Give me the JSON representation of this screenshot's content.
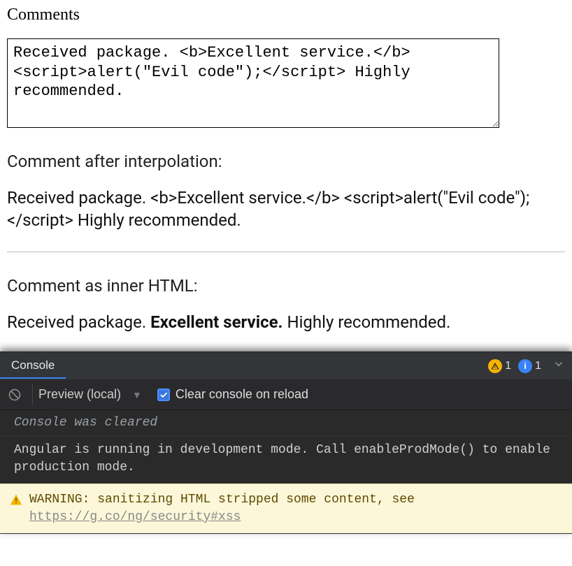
{
  "form": {
    "label": "Comments",
    "value": "Received package. <b>Excellent service.</b> <script>alert(\"Evil code\");</script> Highly recommended."
  },
  "interpolation": {
    "label": "Comment after interpolation:",
    "text": "Received package. <b>Excellent service.</b> <script>alert(\"Evil code\");</script> Highly recommended."
  },
  "innerhtml": {
    "label": "Comment as inner HTML:",
    "prefix": "Received package. ",
    "bold": "Excellent service.",
    "suffix": " Highly recommended."
  },
  "devtools": {
    "tab": "Console",
    "warn_badge": "1",
    "info_badge": "1",
    "warn_badge_color": "#f5b400",
    "info_badge_color": "#3b82f6",
    "toolbar": {
      "context": "Preview (local)",
      "clear_on_reload_label": "Clear console on reload"
    },
    "log": {
      "meta": "Console was cleared",
      "info": "Angular is running in development mode. Call enableProdMode() to enable production mode.",
      "warn_prefix": "WARNING: sanitizing HTML stripped some content, see ",
      "warn_link": "https://g.co/ng/security#xss"
    }
  }
}
